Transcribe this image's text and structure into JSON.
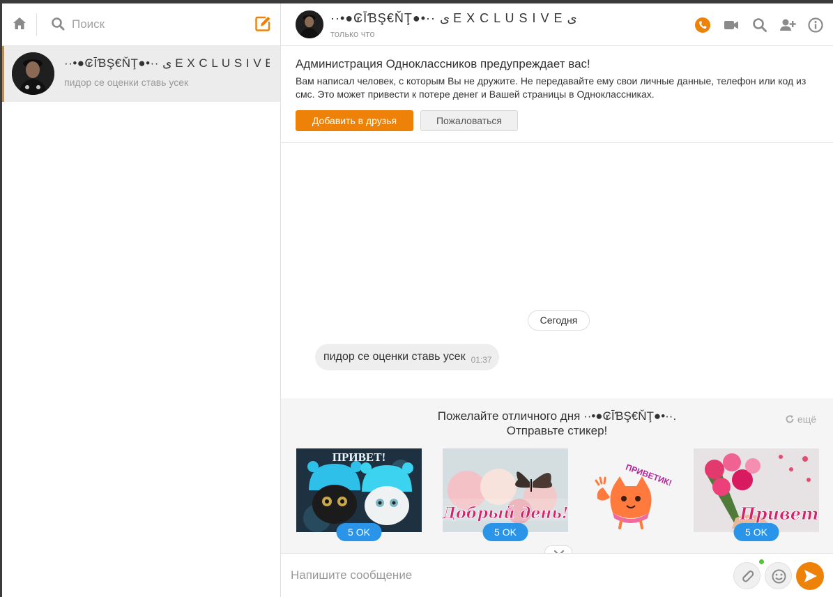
{
  "colors": {
    "accent": "#ee8208",
    "price": "#2a94e8",
    "online": "#56c235"
  },
  "icons": {
    "home": "home-icon",
    "search": "search-icon",
    "compose": "compose-icon",
    "call": "phone-icon",
    "video": "video-icon",
    "find": "search-icon",
    "add_member": "add-user-icon",
    "info": "info-icon",
    "refresh": "refresh-icon",
    "attach": "paperclip-icon",
    "emoji": "smiley-icon",
    "send": "send-icon",
    "collapse": "chevron-down-icon"
  },
  "sidebar": {
    "search_placeholder": "Поиск",
    "chats": [
      {
        "name": "··•●₢ĪƁŞ€ŇŢ●•·· ى E X C L U S I V E ى",
        "snippet": "пидор се оценки ставь усек"
      }
    ]
  },
  "header": {
    "name": "··•●₢ĪƁŞ€ŇŢ●•·· ى E X C L U S I V E ى",
    "status": "только что"
  },
  "warning": {
    "title": "Администрация Одноклассников предупреждает вас!",
    "text": "Вам написал человек, с которым Вы не дружите. Не передавайте ему свои личные данные, телефон или код из смс. Это может привести к потере денег и Вашей страницы в Одноклассниках.",
    "add_friend": "Добавить в друзья",
    "complain": "Пожаловаться"
  },
  "messages": {
    "date": "Сегодня",
    "items": [
      {
        "text": "пидор се оценки ставь усек",
        "time": "01:37"
      }
    ]
  },
  "stickers": {
    "title_line1": "Пожелайте отличного дня ··•●₢ĪƁŞ€ŇŢ●•··.",
    "title_line2": "Отправьте стикер!",
    "more": "ещё",
    "items": [
      {
        "caption": "ПРИВЕТ!",
        "price": "5 OK"
      },
      {
        "caption": "Добрый день!",
        "price": "5 OK"
      },
      {
        "caption": "ПРИВЕТИК!",
        "price": ""
      },
      {
        "caption": "Привет!",
        "price": "5 OK"
      }
    ]
  },
  "composer": {
    "placeholder": "Напишите сообщение"
  }
}
